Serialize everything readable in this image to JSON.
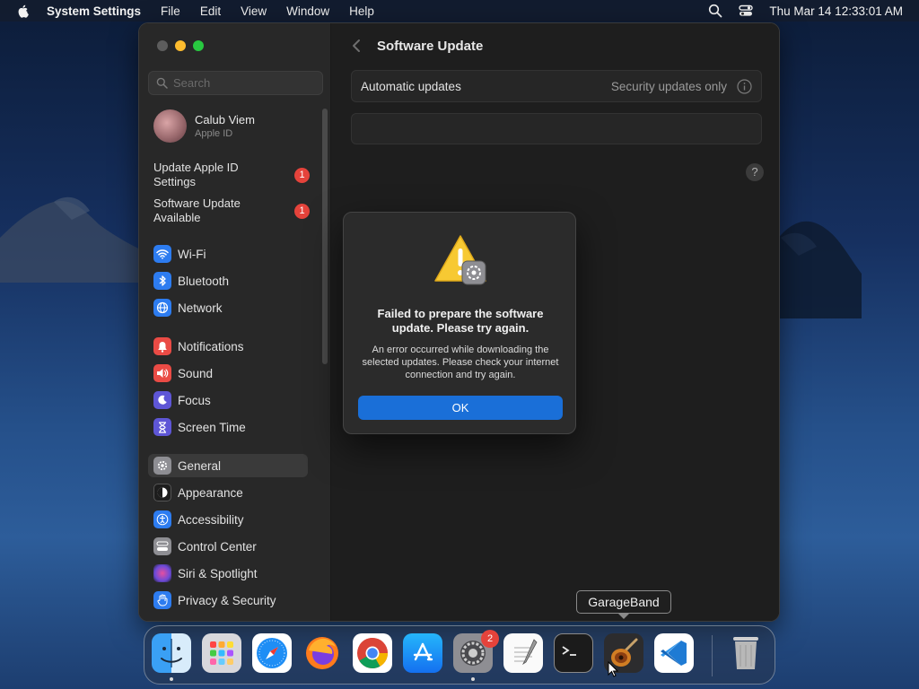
{
  "menubar": {
    "apple_icon": "apple-logo-icon",
    "app_name": "System Settings",
    "menus": [
      "File",
      "Edit",
      "View",
      "Window",
      "Help"
    ],
    "clock": "Thu Mar 14  12:33:01 AM"
  },
  "window": {
    "sidebar": {
      "search_placeholder": "Search",
      "profile": {
        "name": "Calub Viem",
        "subtitle": "Apple ID"
      },
      "notices": [
        {
          "label": "Update Apple ID Settings",
          "badge": "1"
        },
        {
          "label": "Software Update Available",
          "badge": "1"
        }
      ],
      "items": [
        {
          "label": "Wi-Fi",
          "icon": "wifi-icon",
          "color": "#2d7cf0"
        },
        {
          "label": "Bluetooth",
          "icon": "bluetooth-icon",
          "color": "#2d7cf0"
        },
        {
          "label": "Network",
          "icon": "globe-icon",
          "color": "#2d7cf0"
        },
        {
          "label": "Notifications",
          "icon": "bell-icon",
          "color": "#ea4b45"
        },
        {
          "label": "Sound",
          "icon": "speaker-icon",
          "color": "#ea4b45"
        },
        {
          "label": "Focus",
          "icon": "moon-icon",
          "color": "#5e56d6"
        },
        {
          "label": "Screen Time",
          "icon": "hourglass-icon",
          "color": "#5e56d6"
        },
        {
          "label": "General",
          "icon": "gear-icon",
          "color": "#8e8e93",
          "selected": true
        },
        {
          "label": "Appearance",
          "icon": "appearance-icon",
          "color": "#1d1d1d"
        },
        {
          "label": "Accessibility",
          "icon": "accessibility-icon",
          "color": "#2d7cf0"
        },
        {
          "label": "Control Center",
          "icon": "control-center-icon",
          "color": "#8e8e93"
        },
        {
          "label": "Siri & Spotlight",
          "icon": "siri-icon",
          "color": "#b33fc0"
        },
        {
          "label": "Privacy & Security",
          "icon": "hand-icon",
          "color": "#2d7cf0"
        }
      ]
    },
    "main": {
      "title": "Software Update",
      "automatic_updates_label": "Automatic updates",
      "automatic_updates_value": "Security updates only",
      "help": "?"
    }
  },
  "alert": {
    "heading": "Failed to prepare the software update. Please try again.",
    "body": "An error occurred while downloading the selected updates. Please check your internet connection and try again.",
    "ok_label": "OK"
  },
  "dock": {
    "apps": [
      {
        "name": "Finder",
        "icon": "finder-icon",
        "running": true
      },
      {
        "name": "Launchpad",
        "icon": "launchpad-icon",
        "running": false
      },
      {
        "name": "Safari",
        "icon": "safari-icon",
        "running": false
      },
      {
        "name": "Firefox",
        "icon": "firefox-icon",
        "running": false
      },
      {
        "name": "Chrome",
        "icon": "chrome-icon",
        "running": false
      },
      {
        "name": "App Store",
        "icon": "app-store-icon",
        "running": false
      },
      {
        "name": "System Settings",
        "icon": "system-settings-icon",
        "running": true,
        "badge": "2"
      },
      {
        "name": "TextEdit",
        "icon": "textedit-icon",
        "running": false
      },
      {
        "name": "Terminal",
        "icon": "terminal-icon",
        "running": false
      },
      {
        "name": "GarageBand",
        "icon": "garageband-icon",
        "running": false
      },
      {
        "name": "VS Code",
        "icon": "vscode-icon",
        "running": false
      },
      {
        "name": "Trash",
        "icon": "trash-icon",
        "running": false
      }
    ],
    "tooltip": "GarageBand",
    "settings_badge": "2"
  },
  "colors": {
    "accent": "#1a6fd8",
    "badge": "#e5433b",
    "window_bg": "#1e1e1e",
    "sidebar_bg": "#282828"
  }
}
